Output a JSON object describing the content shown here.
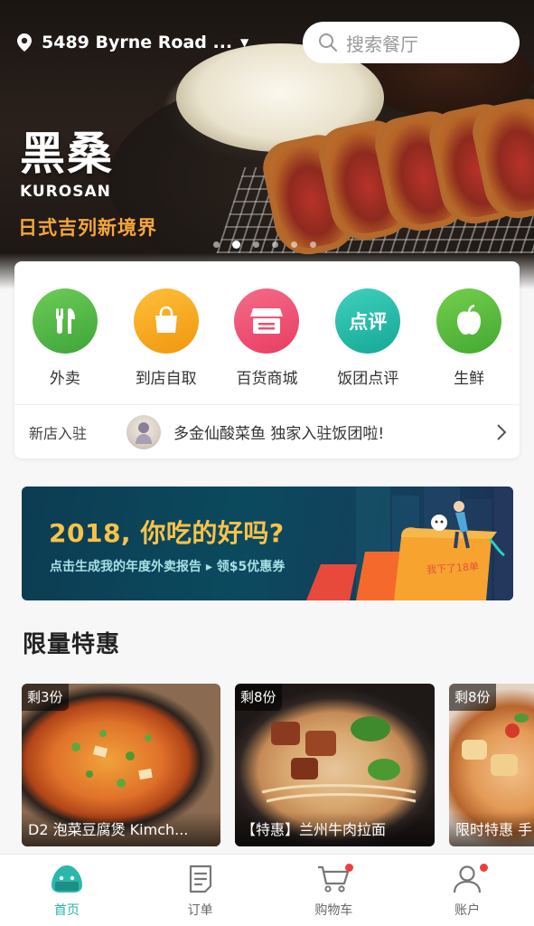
{
  "header": {
    "location": "5489 Byrne Road ...",
    "search_placeholder": "搜索餐厅"
  },
  "hero_banner": {
    "brand_cn": "黑桑",
    "brand_en": "KUROSAN",
    "slogan": "日式吉列新境界",
    "page_count": 6,
    "active_page": 2
  },
  "categories": [
    {
      "label": "外卖",
      "icon": "fork-knife-icon",
      "color": "#4fb845"
    },
    {
      "label": "到店自取",
      "icon": "shopping-bag-icon",
      "color": "#f4a51c"
    },
    {
      "label": "百货商城",
      "icon": "storefront-icon",
      "color": "#ef4e6f"
    },
    {
      "label": "饭团点评",
      "icon": "review-badge-icon",
      "color": "#1fb9a6"
    },
    {
      "label": "生鲜",
      "icon": "apple-icon",
      "color": "#5abc3b"
    }
  ],
  "review_icon_text": "点评",
  "news": {
    "tag": "新店入驻",
    "text": "多金仙酸菜鱼 独家入驻饭团啦!"
  },
  "promo": {
    "title": "2018, 你吃的好吗?",
    "subtitle": "点击生成我的年度外卖报告 ▸ 领$5优惠券",
    "scroll_text": "我下了18单"
  },
  "section": {
    "title": "限量特惠"
  },
  "deals": [
    {
      "badge": "剩3份",
      "caption": "D2 泡菜豆腐煲 Kimch..."
    },
    {
      "badge": "剩8份",
      "caption": "【特惠】兰州牛肉拉面"
    },
    {
      "badge": "剩8份",
      "caption": "限时特惠 手"
    }
  ],
  "tabbar": [
    {
      "label": "首页",
      "icon": "rice-ball-icon",
      "active": true
    },
    {
      "label": "订单",
      "icon": "order-list-icon",
      "active": false
    },
    {
      "label": "购物车",
      "icon": "cart-icon",
      "active": false,
      "dot": true
    },
    {
      "label": "账户",
      "icon": "user-icon",
      "active": false,
      "dot": true
    }
  ],
  "colors": {
    "accent": "#26b3a6",
    "badge_red": "#f03c3c",
    "slogan": "#f4a63c",
    "promo_title": "#f8c24a"
  }
}
